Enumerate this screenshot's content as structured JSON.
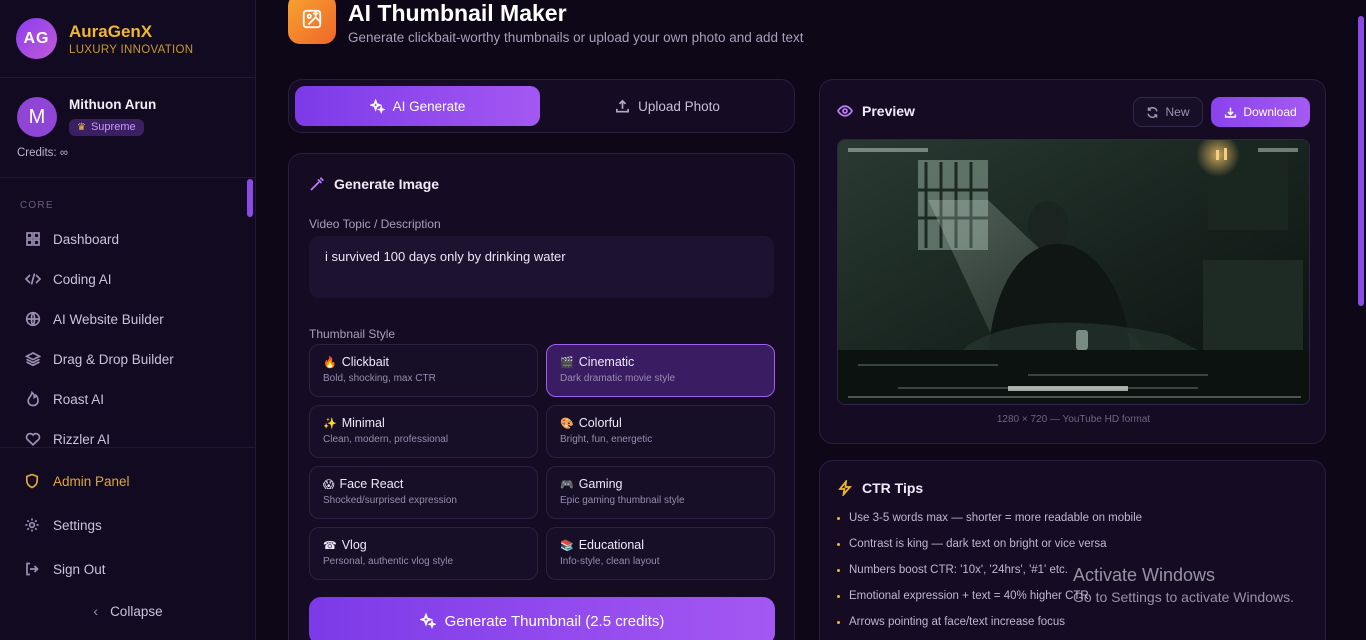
{
  "brand": {
    "logo": "AG",
    "name": "AuraGenX",
    "tagline": "LUXURY INNOVATION"
  },
  "user": {
    "initial": "M",
    "name": "Mithuon Arun",
    "tier": "Supreme",
    "credits": "Credits: ∞"
  },
  "nav": {
    "heading": "CORE",
    "items": [
      {
        "label": "Dashboard",
        "icon": "grid-icon"
      },
      {
        "label": "Coding AI",
        "icon": "code-icon"
      },
      {
        "label": "AI Website Builder",
        "icon": "globe-icon"
      },
      {
        "label": "Drag & Drop Builder",
        "icon": "layers-icon"
      },
      {
        "label": "Roast AI",
        "icon": "flame-icon"
      },
      {
        "label": "Rizzler AI",
        "icon": "heart-icon"
      }
    ]
  },
  "sidebar_bottom": {
    "admin": "Admin Panel",
    "settings": "Settings",
    "signout": "Sign Out",
    "collapse": "Collapse"
  },
  "header": {
    "title": "AI Thumbnail Maker",
    "subtitle": "Generate clickbait-worthy thumbnails or upload your own photo and add text"
  },
  "tabs": {
    "active": "AI Generate",
    "inactive": "Upload Photo"
  },
  "generate": {
    "title": "Generate Image",
    "topic_label": "Video Topic / Description",
    "topic_value": "i survived 100 days only by drinking water",
    "style_label": "Thumbnail Style",
    "styles": [
      {
        "emoji": "🔥",
        "name": "Clickbait",
        "desc": "Bold, shocking, max CTR"
      },
      {
        "emoji": "🎬",
        "name": "Cinematic",
        "desc": "Dark dramatic movie style"
      },
      {
        "emoji": "✨",
        "name": "Minimal",
        "desc": "Clean, modern, professional"
      },
      {
        "emoji": "🎨",
        "name": "Colorful",
        "desc": "Bright, fun, energetic"
      },
      {
        "emoji": "😱",
        "name": "Face React",
        "desc": "Shocked/surprised expression"
      },
      {
        "emoji": "🎮",
        "name": "Gaming",
        "desc": "Epic gaming thumbnail style"
      },
      {
        "emoji": "☎",
        "name": "Vlog",
        "desc": "Personal, authentic vlog style"
      },
      {
        "emoji": "📚",
        "name": "Educational",
        "desc": "Info-style, clean layout"
      }
    ],
    "selected_style": "Cinematic",
    "button": "Generate Thumbnail (2.5 credits)"
  },
  "preview": {
    "title": "Preview",
    "new_label": "New",
    "download_label": "Download",
    "caption": "1280 × 720 — YouTube HD format"
  },
  "tips": {
    "title": "CTR Tips",
    "items": [
      "Use 3-5 words max — shorter = more readable on mobile",
      "Contrast is king — dark text on bright or vice versa",
      "Numbers boost CTR: '10x', '24hrs', '#1' etc.",
      "Emotional expression + text = 40% higher CTR",
      "Arrows pointing at face/text increase focus"
    ]
  },
  "watermark": {
    "line1": "Activate Windows",
    "line2": "Go to Settings to activate Windows."
  },
  "colors": {
    "accent": "#8b45ee",
    "gold": "#f0b72f",
    "background": "#0d0718",
    "card": "#150c23"
  }
}
